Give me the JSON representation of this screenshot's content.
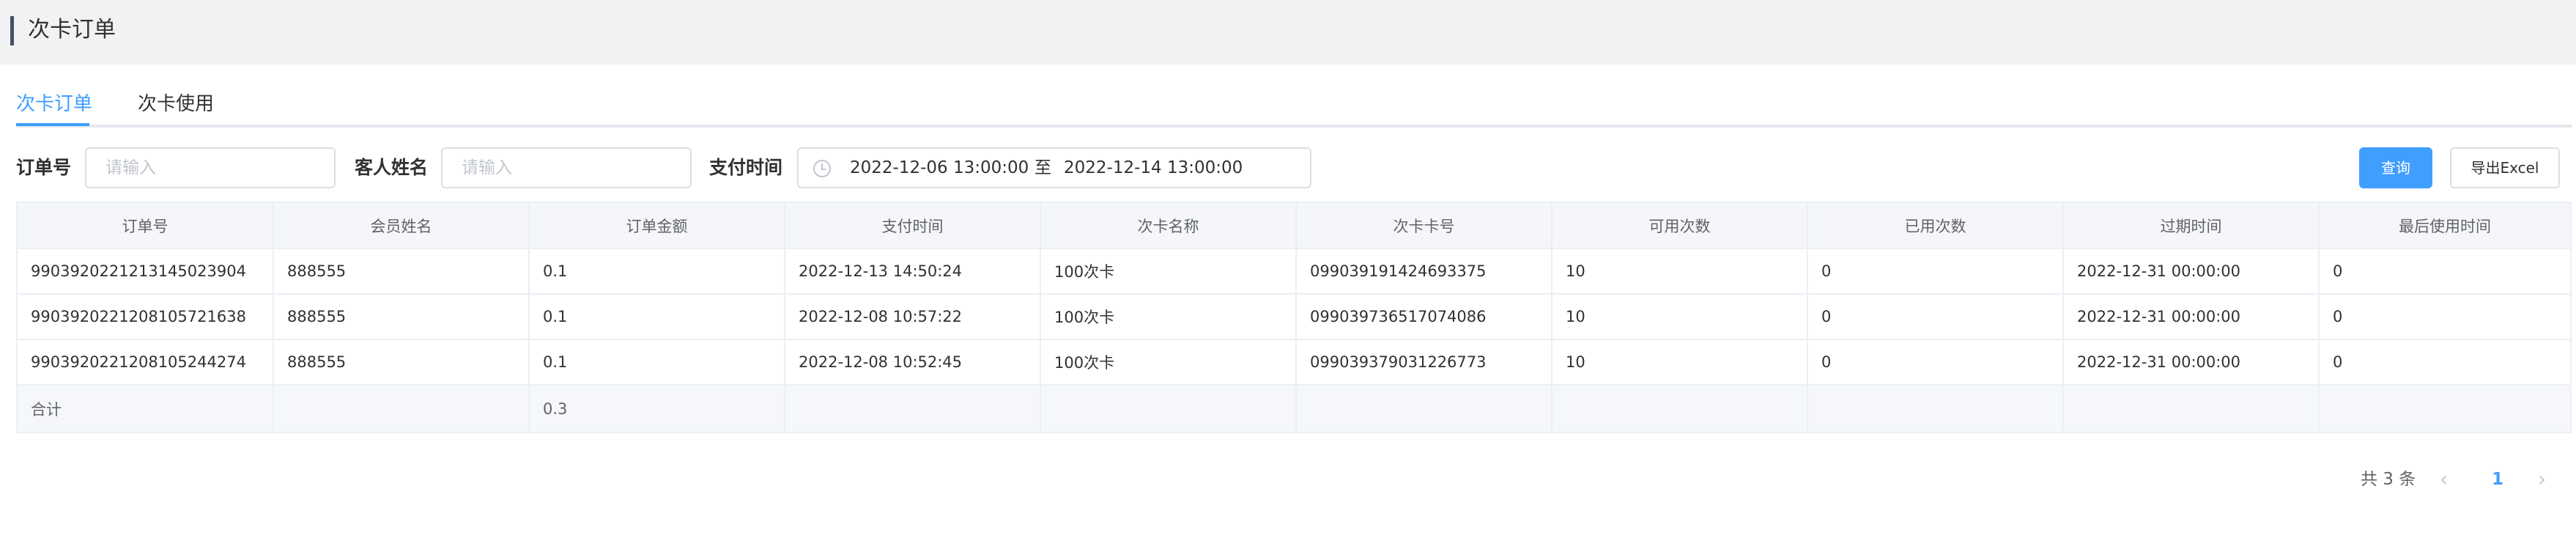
{
  "header": {
    "title": "次卡订单"
  },
  "tabs": [
    {
      "label": "次卡订单",
      "active": true
    },
    {
      "label": "次卡使用",
      "active": false
    }
  ],
  "filters": {
    "order_no": {
      "label": "订单号",
      "placeholder": "请输入"
    },
    "customer_name": {
      "label": "客人姓名",
      "placeholder": "请输入"
    },
    "pay_time": {
      "label": "支付时间",
      "start": "2022-12-06 13:00:00",
      "separator": "至",
      "end": "2022-12-14 13:00:00"
    }
  },
  "buttons": {
    "query": "查询",
    "export": "导出Excel"
  },
  "table": {
    "columns": [
      "订单号",
      "会员姓名",
      "订单金额",
      "支付时间",
      "次卡名称",
      "次卡卡号",
      "可用次数",
      "已用次数",
      "过期时间",
      "最后使用时间"
    ],
    "rows": [
      [
        "990392022121314502390​4",
        "888555",
        "0.1",
        "2022-12-13 14:50:24",
        "100次卡",
        "099039191424693375",
        "10",
        "0",
        "2022-12-31 00:00:00",
        "0"
      ],
      [
        "9903920221208105721638",
        "888555",
        "0.1",
        "2022-12-08 10:57:22",
        "100次卡",
        "099039736517074086",
        "10",
        "0",
        "2022-12-31 00:00:00",
        "0"
      ],
      [
        "9903920221208105244274",
        "888555",
        "0.1",
        "2022-12-08 10:52:45",
        "100次卡",
        "099039379031226773",
        "10",
        "0",
        "2022-12-31 00:00:00",
        "0"
      ]
    ],
    "summary": {
      "label": "合计",
      "amount": "0.3"
    }
  },
  "pagination": {
    "total": "共 3 条",
    "current": "1",
    "prev_icon": "chevron-left-icon",
    "next_icon": "chevron-right-icon"
  },
  "colors": {
    "accent": "#409eff",
    "header_bg": "#f2f2f2",
    "border": "#ebeef5"
  }
}
